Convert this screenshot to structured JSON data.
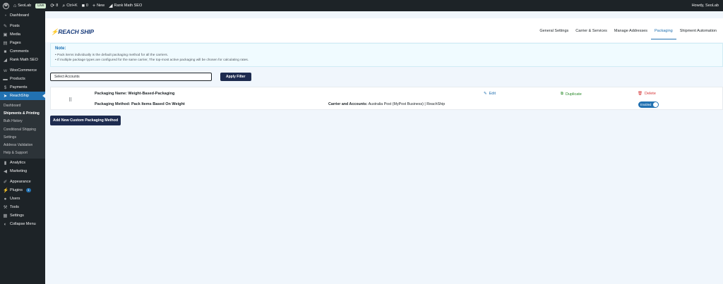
{
  "adminbar": {
    "site_name": "SeoLab",
    "live_badge": "Live",
    "updates_count": "8",
    "search_label": "Ctrl+K",
    "comments_count": "0",
    "new_label": "New",
    "rankmath_label": "Rank Math SEO",
    "howdy": "Howdy, SeoLab"
  },
  "sidebar": {
    "items": [
      {
        "label": "Dashboard",
        "icon": "dashboard-icon"
      },
      {
        "label": "Posts",
        "icon": "pin-icon"
      },
      {
        "label": "Media",
        "icon": "media-icon"
      },
      {
        "label": "Pages",
        "icon": "page-icon"
      },
      {
        "label": "Comments",
        "icon": "comment-icon"
      },
      {
        "label": "Rank Math SEO",
        "icon": "chart-icon"
      },
      {
        "label": "WooCommerce",
        "icon": "woo-icon"
      },
      {
        "label": "Products",
        "icon": "box-icon"
      },
      {
        "label": "Payments",
        "icon": "dollar-icon"
      },
      {
        "label": "ReachShip",
        "icon": "ship-icon"
      }
    ],
    "submenu": [
      "Dashboard",
      "Shipments & Printing",
      "Bulk History",
      "Conditional Shipping",
      "Settings",
      "Address Validation",
      "Help & Support"
    ],
    "items_after": [
      {
        "label": "Analytics",
        "icon": "bar-chart-icon"
      },
      {
        "label": "Marketing",
        "icon": "megaphone-icon"
      },
      {
        "label": "Appearance",
        "icon": "brush-icon"
      },
      {
        "label": "Plugins",
        "icon": "plug-icon",
        "badge": "1"
      },
      {
        "label": "Users",
        "icon": "user-icon"
      },
      {
        "label": "Tools",
        "icon": "wrench-icon"
      },
      {
        "label": "Settings",
        "icon": "settings-icon"
      },
      {
        "label": "Collapse Menu",
        "icon": "collapse-icon"
      }
    ]
  },
  "header": {
    "logo_text": "REACH SHIP",
    "tabs": [
      "General Settings",
      "Carrier & Services",
      "Manage Addresses",
      "Packaging",
      "Shipment Automation"
    ],
    "active_tab": "Packaging"
  },
  "note": {
    "title": "Note:",
    "lines": [
      "Pack items individually is the default packaging method for all the carriers.",
      "If multiple package types are configured for the same carrier, The top-most active packaging will be chosen for calculating rates."
    ]
  },
  "filter": {
    "select_value": "Select Accounts",
    "apply_label": "Apply Filter"
  },
  "packaging": {
    "name_label": "Packaging Name:",
    "name_value": "Weight-Based-Packaging",
    "method_label": "Packaging Method:",
    "method_value": "Pack Items Based On Weight",
    "carrier_label": "Carrier and Accounts:",
    "carrier_value": "Australia Post (MyPost Business) | ReachShip",
    "edit_label": "Edit",
    "duplicate_label": "Duplicate",
    "delete_label": "Delete",
    "status_label": "Enabled"
  },
  "add_button_label": "Add New Custom Packaging Method",
  "colors": {
    "admin_dark": "#1d2327",
    "accent": "#2271b1",
    "button_dark": "#1d2b4f",
    "delete_red": "#d63638",
    "duplicate_green": "#2a8a2a"
  }
}
